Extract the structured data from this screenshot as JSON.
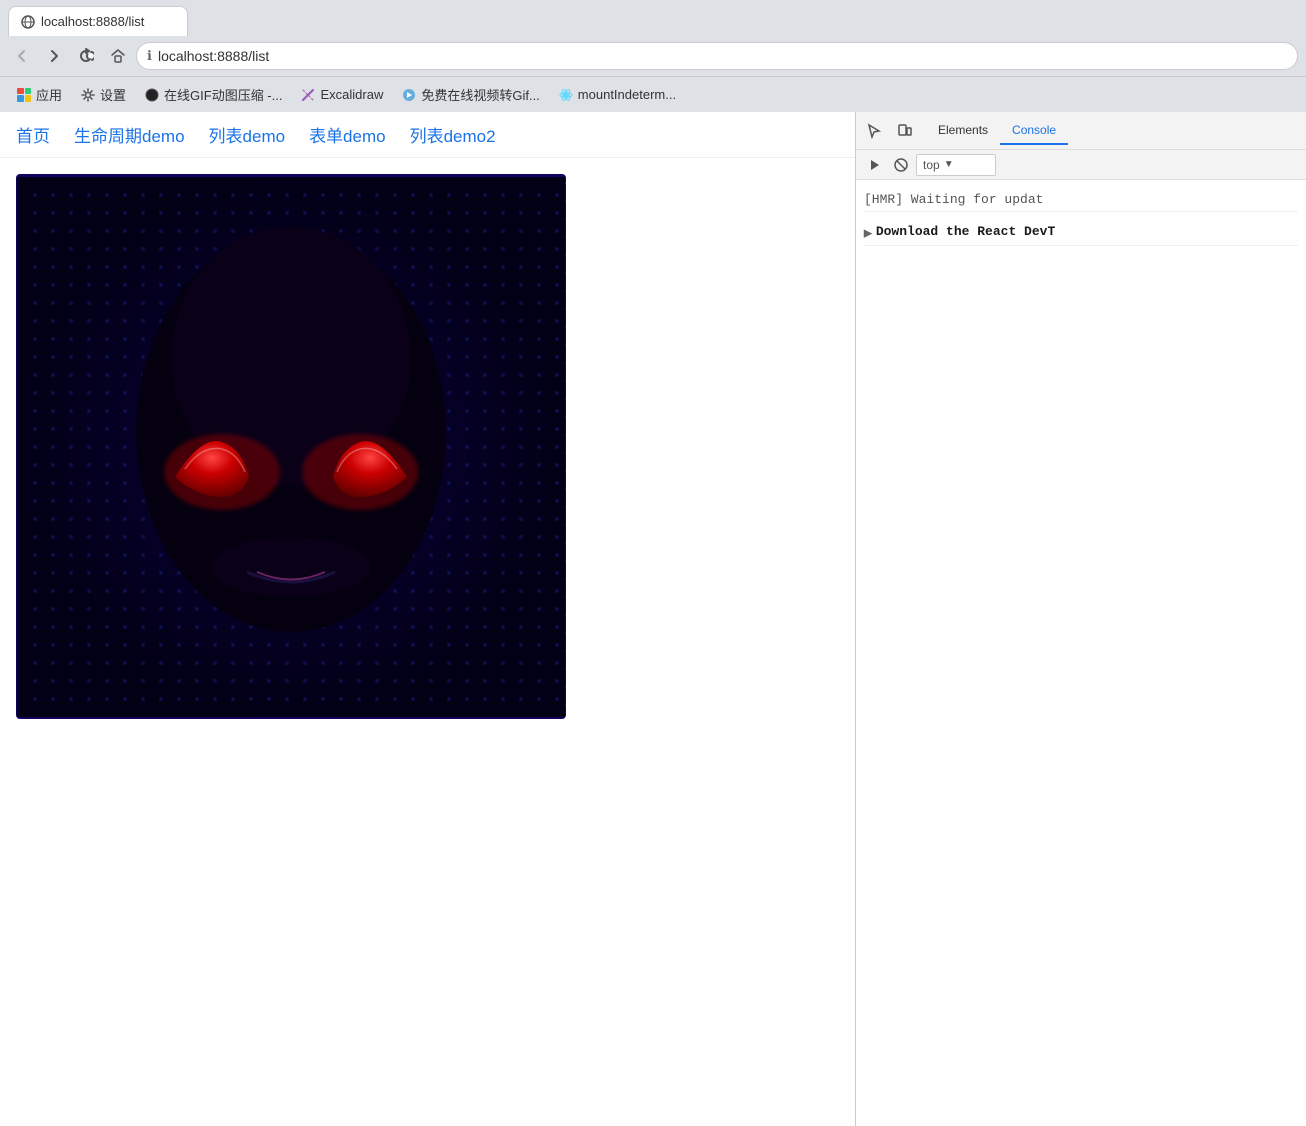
{
  "browser": {
    "tab": {
      "title": "localhost:8888/list",
      "favicon": "globe"
    },
    "nav": {
      "back_disabled": true,
      "forward_disabled": false,
      "url": "localhost:8888/list"
    },
    "bookmarks": [
      {
        "label": "应用",
        "icon": "apps"
      },
      {
        "label": "设置",
        "icon": "gear"
      },
      {
        "label": "在线GIF动图压缩 -...",
        "icon": "record"
      },
      {
        "label": "Excalidraw",
        "icon": "pencil"
      },
      {
        "label": "免费在线视频转Gif...",
        "icon": "lightning"
      },
      {
        "label": "mountIndeterm...",
        "icon": "react"
      }
    ]
  },
  "webpage": {
    "nav_links": [
      {
        "label": "首页"
      },
      {
        "label": "生命周期demo"
      },
      {
        "label": "列表demo"
      },
      {
        "label": "表单demo"
      },
      {
        "label": "列表demo2"
      }
    ],
    "image": {
      "alt": "Alien face with red eyes on dark blue background"
    }
  },
  "devtools": {
    "tabs": [
      {
        "label": "Elements"
      },
      {
        "label": "Console",
        "active": true
      }
    ],
    "toolbar_icons": [
      "cursor-icon",
      "device-icon"
    ],
    "subtoolbar": {
      "play_icon": "▶",
      "block_icon": "🚫",
      "filter_label": "top"
    },
    "console": {
      "messages": [
        {
          "text": "[HMR] Waiting for updat",
          "type": "hmr"
        },
        {
          "text": "",
          "type": "separator"
        },
        {
          "text": "Download the React DevT",
          "type": "react-devtools",
          "has_chevron": true
        }
      ]
    }
  }
}
